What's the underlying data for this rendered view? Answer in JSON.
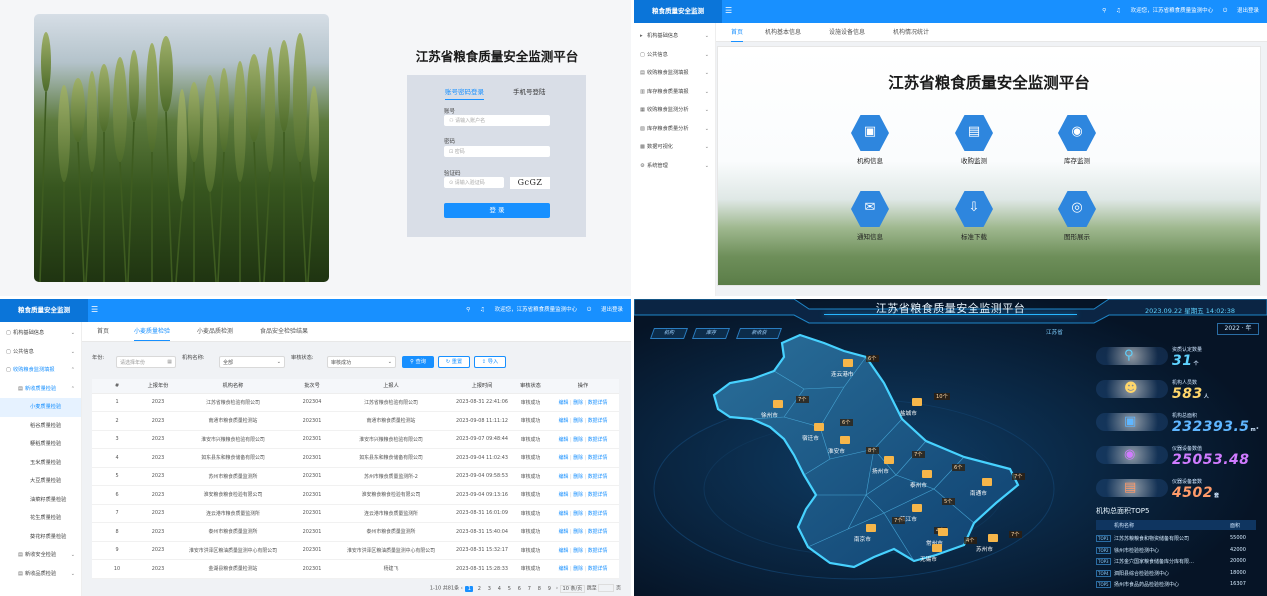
{
  "login": {
    "title": "江苏省粮食质量安全监测平台",
    "tab_account": "账号密码登录",
    "tab_phone": "手机号登陆",
    "account_label": "账号",
    "account_placeholder": "请输入账户名",
    "password_label": "密码",
    "password_placeholder": "密码",
    "captcha_label": "验证码",
    "captcha_placeholder": "请输入验证码",
    "captcha_text": "GcGZ",
    "submit": "登 录"
  },
  "app": {
    "brand": "粮食质量安全监测",
    "welcome": "欢迎您，江苏省粮食质量监测中心",
    "logout": "退出登录"
  },
  "home": {
    "sidebar": [
      {
        "icon": "org-icon",
        "label": "机构基础信息"
      },
      {
        "icon": "announcement-icon",
        "label": "公共信息"
      },
      {
        "icon": "harvest-icon",
        "label": "收购粮食监测填报"
      },
      {
        "icon": "storage-icon",
        "label": "库存粮食质量填报"
      },
      {
        "icon": "harvest-analysis-icon",
        "label": "收购粮食监测分析"
      },
      {
        "icon": "storage-analysis-icon",
        "label": "库存粮食质量分析"
      },
      {
        "icon": "chart-icon",
        "label": "数据可视化"
      },
      {
        "icon": "settings-icon",
        "label": "系统管理"
      }
    ],
    "tabs": [
      "首页",
      "机构基本信息",
      "设施设备信息",
      "机构情况统计"
    ],
    "active_tab": "首页",
    "title": "江苏省粮食质量安全监测平台",
    "tiles": [
      {
        "icon": "institution-icon",
        "label": "机构信息"
      },
      {
        "icon": "harvest-monitor-icon",
        "label": "收购监测"
      },
      {
        "icon": "storage-monitor-icon",
        "label": "库存监测"
      },
      {
        "icon": "notice-icon",
        "label": "通知信息"
      },
      {
        "icon": "download-icon",
        "label": "标准下载"
      },
      {
        "icon": "gallery-icon",
        "label": "图形展示"
      }
    ]
  },
  "wheat": {
    "sidebar": [
      {
        "label": "机构基础信息",
        "level": 0
      },
      {
        "label": "公共信息",
        "level": 0
      },
      {
        "label": "收购粮食监测填报",
        "level": 0,
        "active": true
      },
      {
        "label": "新收质量检验",
        "level": 1,
        "active": true
      },
      {
        "label": "小麦质量检验",
        "level": 2,
        "selected": true
      },
      {
        "label": "稻谷质量检验",
        "level": 2
      },
      {
        "label": "粳稻质量检验",
        "level": 2
      },
      {
        "label": "玉米质量检验",
        "level": 2
      },
      {
        "label": "大豆质量检验",
        "level": 2
      },
      {
        "label": "油菜籽质量检验",
        "level": 2
      },
      {
        "label": "花生质量检验",
        "level": 2
      },
      {
        "label": "葵花籽质量检验",
        "level": 2
      },
      {
        "label": "新收安全检验",
        "level": 1
      },
      {
        "label": "新收品质检验",
        "level": 1
      }
    ],
    "tabs": [
      "首页",
      "小麦质量检验",
      "小麦品质检测",
      "食品安全检验结果"
    ],
    "active_tab": "小麦质量检验",
    "filters": {
      "year_label": "年份:",
      "year_placeholder": "请选择年份",
      "org_label": "机构名称:",
      "org_value": "全部",
      "status_label": "审核状态:",
      "status_value": "审核成功",
      "query": "查询",
      "reset": "重置",
      "import": "导入"
    },
    "columns": [
      "#",
      "上报年份",
      "机构名称",
      "批次号",
      "上报人",
      "上报时间",
      "审核状态",
      "操作"
    ],
    "rows": [
      [
        "1",
        "2023",
        "江苏省粮食检验有限公司",
        "202304",
        "江苏省粮食检验有限公司",
        "2023-08-31 22:41:06",
        "审核成功"
      ],
      [
        "2",
        "2023",
        "南通市粮食质量检测站",
        "202301",
        "南通市粮食质量检测站",
        "2023-09-08 11:11:12",
        "审核成功"
      ],
      [
        "3",
        "2023",
        "淮安市兴粮粮食检验有限公司",
        "202301",
        "淮安市兴粮粮食检验有限公司",
        "2023-09-07 09:48:44",
        "审核成功"
      ],
      [
        "4",
        "2023",
        "如东县东和粮食储备有限公司",
        "202301",
        "如东县东和粮食储备有限公司",
        "2023-09-04 11:02:43",
        "审核成功"
      ],
      [
        "5",
        "2023",
        "苏州市粮食质量监测所",
        "202301",
        "苏州市粮食质量监测所-2",
        "2023-09-04 09:58:53",
        "审核成功"
      ],
      [
        "6",
        "2023",
        "淮安粮食粮食检验有限公司",
        "202301",
        "淮安粮食粮食检验有限公司",
        "2023-09-04 09:13:16",
        "审核成功"
      ],
      [
        "7",
        "2023",
        "连云港市粮食质量监测所",
        "202301",
        "连云港市粮食质量监测所",
        "2023-08-31 16:01:09",
        "审核成功"
      ],
      [
        "8",
        "2023",
        "泰州市粮食质量监测所",
        "202301",
        "泰州市粮食质量监测所",
        "2023-08-31 15:40:04",
        "审核成功"
      ],
      [
        "9",
        "2023",
        "淮安市洪泽区粮油质量监测中心有限公司",
        "202301",
        "淮安市洪泽区粮油质量监测中心有限公司",
        "2023-08-31 15:32:17",
        "审核成功"
      ],
      [
        "10",
        "2023",
        "金湖县粮食质量检测站",
        "202301",
        "杨建飞",
        "2023-08-31 15:28:33",
        "审核成功"
      ]
    ],
    "ops": [
      "编辑",
      "删除",
      "数据详情"
    ],
    "pager": {
      "total": "1-10 共81条",
      "pages": [
        "1",
        "2",
        "3",
        "4",
        "5",
        "6",
        "7",
        "8",
        "9"
      ],
      "current": "1",
      "page_size": "10 条/页",
      "goto": "跳至",
      "page_unit": "页"
    }
  },
  "dashboard": {
    "title": "江苏省粮食质量安全监测平台",
    "datetime": "2023.09.22 星期五 14:02:38",
    "year": "2022 · 年",
    "buttons": [
      "机构",
      "库存",
      "新收获"
    ],
    "region": "江苏省",
    "cities": [
      {
        "name": "连云港市",
        "count": "6个"
      },
      {
        "name": "徐州市",
        "count": "7个"
      },
      {
        "name": "盐城市",
        "count": "10个"
      },
      {
        "name": "宿迁市",
        "count": "6个"
      },
      {
        "name": "淮安市",
        "count": "8个"
      },
      {
        "name": "扬州市",
        "count": "7个"
      },
      {
        "name": "泰州市",
        "count": "6个"
      },
      {
        "name": "南通市",
        "count": "7个"
      },
      {
        "name": "镇江市",
        "count": "7个"
      },
      {
        "name": "南京市",
        "count": "4个"
      },
      {
        "name": "常州市",
        "count": "4个"
      },
      {
        "name": "无锡市",
        "count": "5个"
      },
      {
        "name": "苏州市",
        "count": "7个"
      }
    ],
    "stats": [
      {
        "label": "资质认定数量",
        "value": "31",
        "unit": "个",
        "color": "#5fd3ff"
      },
      {
        "label": "机构人员数",
        "value": "583",
        "unit": "人",
        "color": "#ffd66b"
      },
      {
        "label": "机构总面积",
        "value": "232393.5",
        "unit": "m²",
        "color": "#5fb6ff"
      },
      {
        "label": "仪器设备数值",
        "value": "25053.48",
        "unit": "",
        "color": "#d07bff"
      },
      {
        "label": "仪器设备套数",
        "value": "4502",
        "unit": "套",
        "color": "#ff9b6a"
      }
    ],
    "top5": {
      "title": "机构总面积TOP5",
      "col_name": "机构名称",
      "col_area": "面积",
      "rows": [
        {
          "rank": "TOP1",
          "name": "江苏苏粮粮食和物资储备有限公司",
          "area": "55000"
        },
        {
          "rank": "TOP2",
          "name": "徐州市检验检测中心",
          "area": "42000"
        },
        {
          "rank": "TOP3",
          "name": "江苏金穴国家粮食储备库分库有限…",
          "area": "20000"
        },
        {
          "rank": "TOP4",
          "name": "泗阳县综合检验检测中心",
          "area": "18000"
        },
        {
          "rank": "TOP5",
          "name": "扬州市食品药品检验检测中心",
          "area": "16307"
        }
      ]
    }
  }
}
